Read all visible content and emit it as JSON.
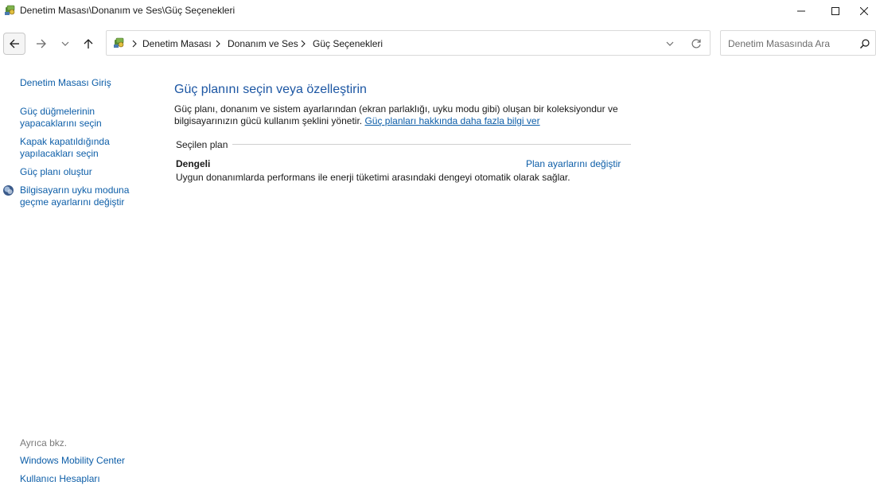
{
  "window": {
    "title": "Denetim Masası\\Donanım ve Ses\\Güç Seçenekleri",
    "icon": "control-panel-icon"
  },
  "navigation": {
    "breadcrumb": [
      "Denetim Masası",
      "Donanım ve Ses",
      "Güç Seçenekleri"
    ],
    "search_placeholder": "Denetim Masasında Ara"
  },
  "sidebar": {
    "items": [
      {
        "label": "Denetim Masası Giriş"
      },
      {
        "label": "Güç düğmelerinin yapacaklarını seçin"
      },
      {
        "label": "Kapak kapatıldığında yapılacakları seçin"
      },
      {
        "label": "Güç planı oluştur"
      },
      {
        "label": "Bilgisayarın uyku moduna geçme ayarlarını değiştir",
        "icon": "shield-icon"
      }
    ],
    "see_also_label": "Ayrıca bkz.",
    "see_also": [
      {
        "label": "Windows Mobility Center"
      },
      {
        "label": "Kullanıcı Hesapları"
      }
    ]
  },
  "main": {
    "title": "Güç planını seçin veya özelleştirin",
    "description": "Güç planı, donanım ve sistem ayarlarından (ekran parlaklığı, uyku modu gibi) oluşan bir koleksiyondur ve bilgisayarınızın gücü kullanım şeklini yönetir.",
    "more_link": "Güç planları hakkında daha fazla bilgi ver",
    "section_label": "Seçilen plan",
    "plan": {
      "name": "Dengeli",
      "change_link": "Plan ayarlarını değiştir",
      "description": "Uygun donanımlarda performans ile enerji tüketimi arasındaki dengeyi otomatik olarak sağlar."
    }
  },
  "colors": {
    "link": "#0d5ea8",
    "title": "#1c56a3",
    "muted": "#7a7a7a"
  }
}
